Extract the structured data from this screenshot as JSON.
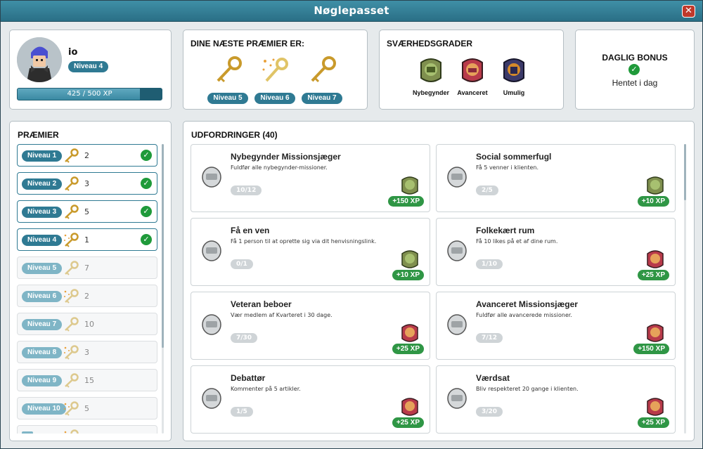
{
  "window": {
    "title": "Nøglepasset",
    "close_label": "✕"
  },
  "profile": {
    "username": "io",
    "level": "Niveau 4",
    "xp_text": "425 / 500 XP",
    "xp_progress": 0.85
  },
  "next_rewards": {
    "heading": "DINE NÆSTE PRÆMIER ER:",
    "items": [
      {
        "level": "Niveau 5",
        "icon": "gold-key-icon"
      },
      {
        "level": "Niveau 6",
        "icon": "sparkle-key-icon"
      },
      {
        "level": "Niveau 7",
        "icon": "gold-key-icon"
      }
    ]
  },
  "difficulty": {
    "heading": "SVÆRHEDSGRADER",
    "items": [
      {
        "label": "Nybegynder",
        "color": "#6a9a3a"
      },
      {
        "label": "Avanceret",
        "color": "#b83a4a"
      },
      {
        "label": "Umulig",
        "color": "#3c3a6a"
      }
    ]
  },
  "daily_bonus": {
    "heading": "DAGLIG BONUS",
    "status": "Hentet i dag"
  },
  "rewards": {
    "heading": "PRÆMIER",
    "items": [
      {
        "level": "Niveau 1",
        "count": "2",
        "done": true,
        "sparkle": false
      },
      {
        "level": "Niveau 2",
        "count": "3",
        "done": true,
        "sparkle": false
      },
      {
        "level": "Niveau 3",
        "count": "5",
        "done": true,
        "sparkle": false
      },
      {
        "level": "Niveau 4",
        "count": "1",
        "done": true,
        "sparkle": true
      },
      {
        "level": "Niveau 5",
        "count": "7",
        "done": false,
        "sparkle": false
      },
      {
        "level": "Niveau 6",
        "count": "2",
        "done": false,
        "sparkle": true
      },
      {
        "level": "Niveau 7",
        "count": "10",
        "done": false,
        "sparkle": false
      },
      {
        "level": "Niveau 8",
        "count": "3",
        "done": false,
        "sparkle": true
      },
      {
        "level": "Niveau 9",
        "count": "15",
        "done": false,
        "sparkle": false
      },
      {
        "level": "Niveau 10",
        "count": "5",
        "done": false,
        "sparkle": true
      },
      {
        "level": "",
        "count": "",
        "done": false,
        "sparkle": true
      }
    ]
  },
  "challenges": {
    "heading": "UDFORDRINGER (40)",
    "items": [
      {
        "title": "Nybegynder Missionsjæger",
        "desc": "Fuldfør alle nybegynder-missioner.",
        "progress": "10/12",
        "xp": "+150 XP",
        "tier": "green",
        "icon": "helmet-icon"
      },
      {
        "title": "Social sommerfugl",
        "desc": "Få 5 venner i klienten.",
        "progress": "2/5",
        "xp": "+10 XP",
        "tier": "green",
        "icon": "id-card-icon"
      },
      {
        "title": "Få en ven",
        "desc": "Få 1 person til at oprette sig via dit henvisningslink.",
        "progress": "0/1",
        "xp": "+10 XP",
        "tier": "green",
        "icon": "friends-icon"
      },
      {
        "title": "Folkekært rum",
        "desc": "Få 10 likes på et af dine rum.",
        "progress": "1/10",
        "xp": "+25 XP",
        "tier": "red",
        "icon": "room-icon"
      },
      {
        "title": "Veteran beboer",
        "desc": "Vær medlem af Kvarteret i 30 dage.",
        "progress": "7/30",
        "xp": "+25 XP",
        "tier": "red",
        "icon": "veteran-icon"
      },
      {
        "title": "Avanceret Missionsjæger",
        "desc": "Fuldfør alle avancerede missioner.",
        "progress": "7/12",
        "xp": "+150 XP",
        "tier": "red",
        "icon": "helmet-icon"
      },
      {
        "title": "Debattør",
        "desc": "Kommenter på 5 artikler.",
        "progress": "1/5",
        "xp": "+25 XP",
        "tier": "red",
        "icon": "article-icon"
      },
      {
        "title": "Værdsat",
        "desc": "Bliv respekteret 20 gange i klienten.",
        "progress": "3/20",
        "xp": "+25 XP",
        "tier": "red",
        "icon": "respect-icon"
      }
    ]
  }
}
